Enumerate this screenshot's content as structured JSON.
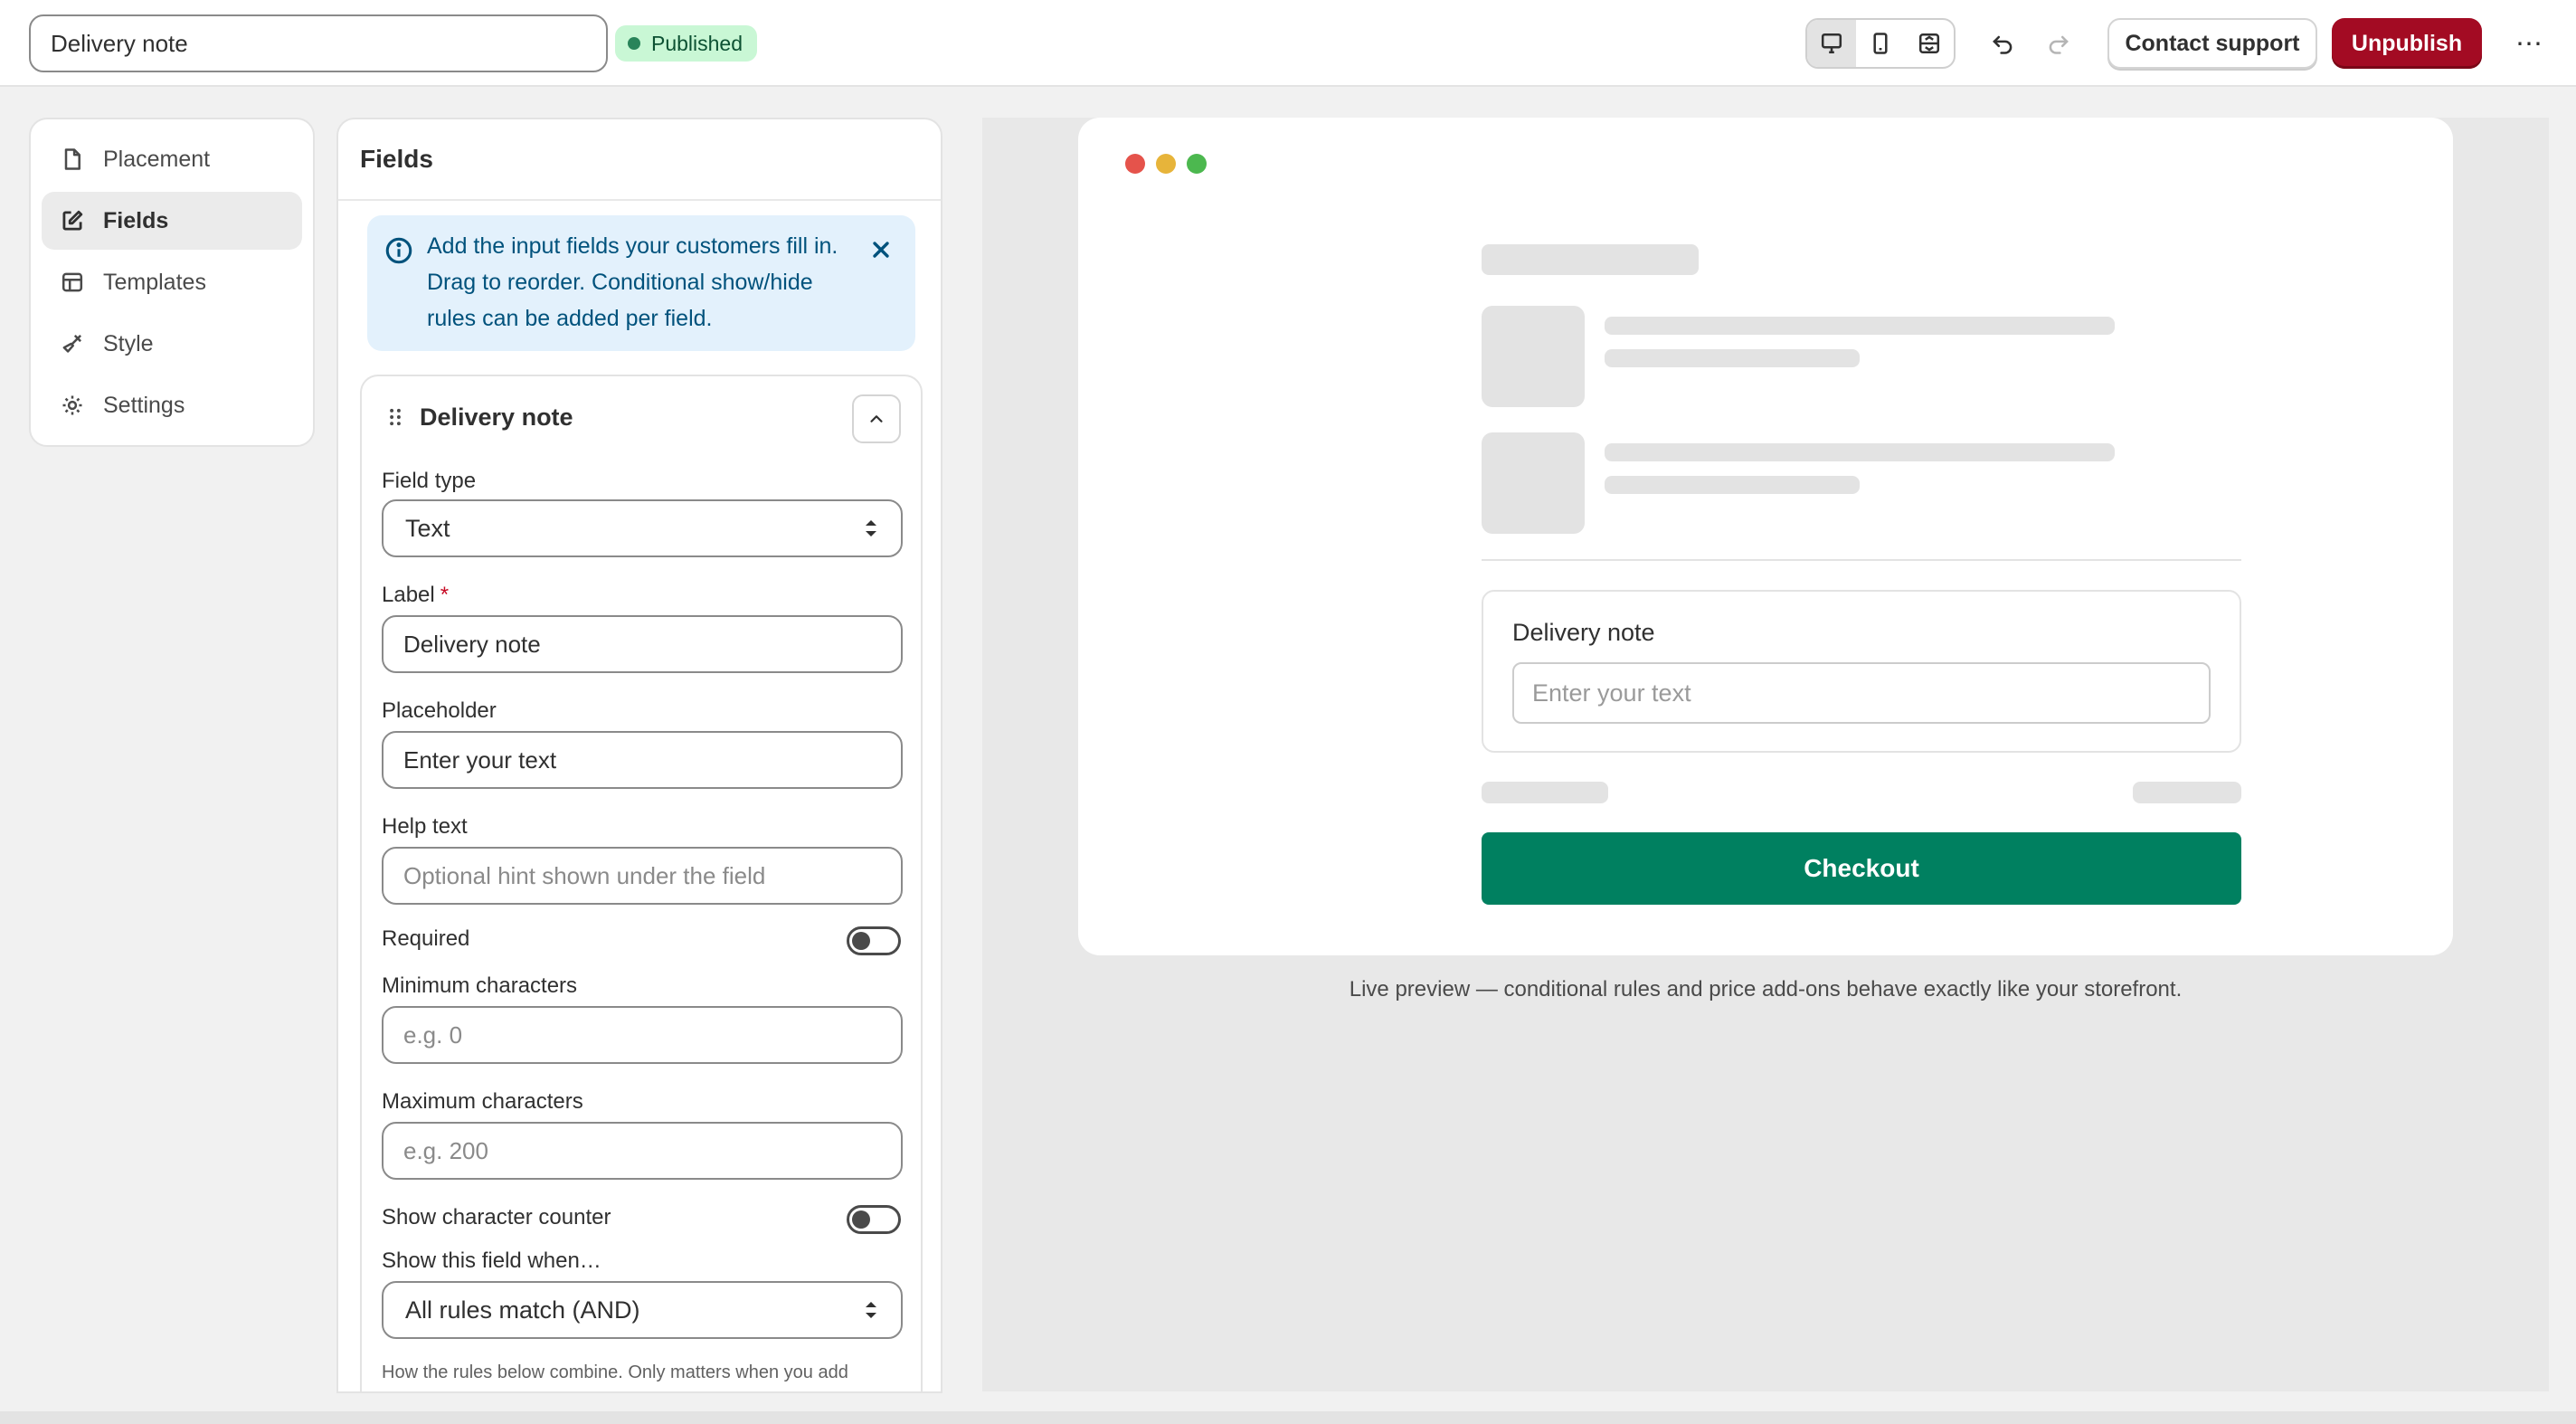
{
  "header": {
    "title_value": "Delivery note",
    "status": "Published",
    "contact_support": "Contact support",
    "unpublish": "Unpublish",
    "more": "⋯"
  },
  "sidebar": {
    "items": [
      {
        "label": "Placement",
        "icon": "page-icon"
      },
      {
        "label": "Fields",
        "icon": "edit-icon",
        "active": true
      },
      {
        "label": "Templates",
        "icon": "layout-icon"
      },
      {
        "label": "Style",
        "icon": "brush-icon"
      },
      {
        "label": "Settings",
        "icon": "gear-icon"
      }
    ]
  },
  "fields_panel": {
    "title": "Fields",
    "info_text": "Add the input fields your customers fill in. Drag to reorder. Conditional show/hide rules can be added per field.",
    "field": {
      "name": "Delivery note",
      "field_type_label": "Field type",
      "field_type_value": "Text",
      "label_label": "Label",
      "label_value": "Delivery note",
      "placeholder_label": "Placeholder",
      "placeholder_value": "Enter your text",
      "help_label": "Help text",
      "help_placeholder": "Optional hint shown under the field",
      "required_label": "Required",
      "required_on": false,
      "min_label": "Minimum characters",
      "min_placeholder": "e.g. 0",
      "max_label": "Maximum characters",
      "max_placeholder": "e.g. 200",
      "counter_label": "Show character counter",
      "counter_on": false,
      "show_when_label": "Show this field when…",
      "show_when_value": "All rules match (AND)",
      "rules_hint": "How the rules below combine. Only matters when you add"
    }
  },
  "preview": {
    "field_label": "Delivery note",
    "field_placeholder": "Enter your text",
    "checkout": "Checkout",
    "caption": "Live preview — conditional rules and price add-ons behave exactly like your storefront."
  },
  "colors": {
    "published_bg": "#c9f7d5",
    "unpublish_bg": "#a30b23",
    "checkout_bg": "#008060",
    "info_bg": "#e3f1fc"
  }
}
